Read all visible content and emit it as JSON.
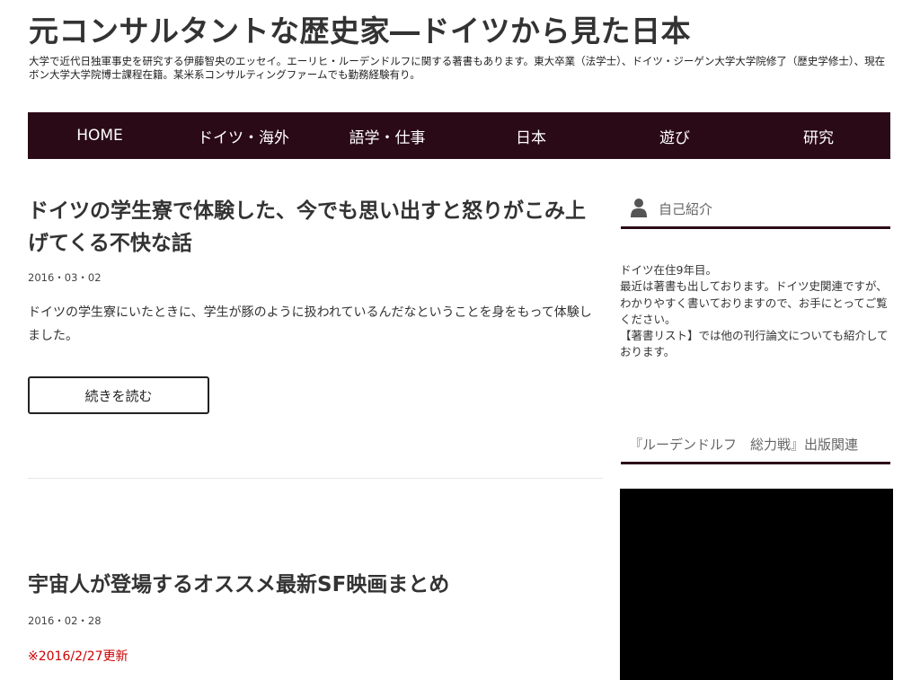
{
  "site": {
    "title": "元コンサルタントな歴史家―ドイツから見た日本",
    "description": "大学で近代日独軍事史を研究する伊藤智央のエッセイ。エーリヒ・ルーデンドルフに関する著書もあります。東大卒業（法学士）、ドイツ・ジーゲン大学大学院修了（歴史学修士）、現在ボン大学大学院博士課程在籍。某米系コンサルティングファームでも勤務経験有り。"
  },
  "nav": {
    "items": [
      {
        "label": "HOME"
      },
      {
        "label": "ドイツ・海外"
      },
      {
        "label": "語学・仕事"
      },
      {
        "label": "日本"
      },
      {
        "label": "遊び"
      },
      {
        "label": "研究"
      }
    ]
  },
  "posts": [
    {
      "title": "ドイツの学生寮で体験した、今でも思い出すと怒りがこみ上げてくる不快な話",
      "date": "2016・03・02",
      "excerpt": "ドイツの学生寮にいたときに、学生が豚のように扱われているんだなということを身をもって体験しました。",
      "more_label": "続きを読む"
    },
    {
      "title": "宇宙人が登場するオススメ最新SF映画まとめ",
      "date": "2016・02・28",
      "note": "※2016/2/27更新"
    }
  ],
  "sidebar": {
    "profile": {
      "title": "自己紹介",
      "icon": "user-icon",
      "text": "ドイツ在住9年目。\n最近は著書も出しております。ドイツ史関連ですが、わかりやすく書いておりますので、お手にとってご覧ください。\n【著書リスト】では他の刊行論文についても紹介しております。"
    },
    "publication": {
      "title": "『ルーデンドルフ　総力戦』出版関連"
    }
  },
  "colors": {
    "nav_bg": "#2b0a17",
    "accent_red": "#cc0000",
    "text": "#333333"
  }
}
